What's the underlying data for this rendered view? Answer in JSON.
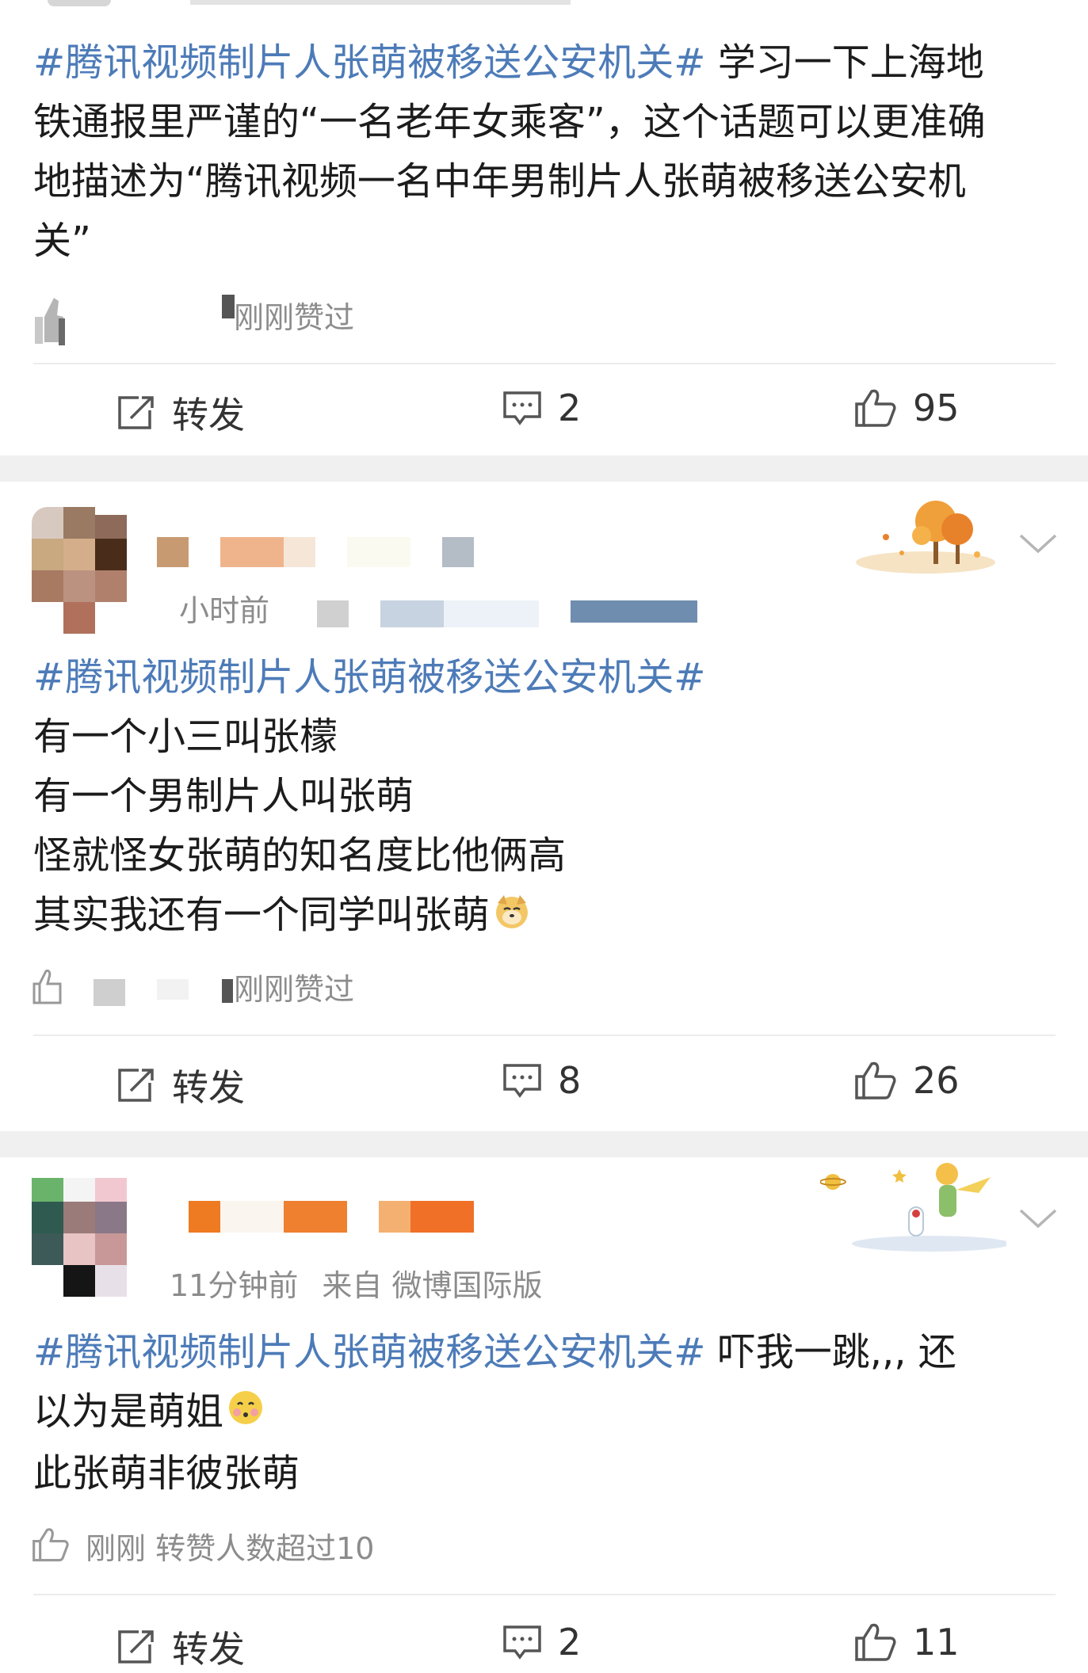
{
  "posts": [
    {
      "text_lines": [
        {
          "topic": "#腾讯视频制片人张萌被移送公安机关#",
          "rest": " 学习一下上海地"
        },
        {
          "topic": "",
          "rest": "铁通报里严谨的“一名老年女乘客”，这个话题可以更准确"
        },
        {
          "topic": "",
          "rest": "地描述为“腾讯视频一名中年男制片人张萌被移送公安机"
        },
        {
          "topic": "",
          "rest": "关”"
        }
      ],
      "like_note": "刚刚赞过",
      "actions": {
        "repost": "转发",
        "comments": "2",
        "likes": "95"
      }
    },
    {
      "time_fragment": "小时前",
      "text_lines": [
        {
          "topic": "#腾讯视频制片人张萌被移送公安机关#",
          "rest": ""
        },
        {
          "topic": "",
          "rest": "有一个小三叫张檬"
        },
        {
          "topic": "",
          "rest": "有一个男制片人叫张萌"
        },
        {
          "topic": "",
          "rest": "怪就怪女张萌的知名度比他俩高"
        },
        {
          "topic": "",
          "rest": "其实我还有一个同学叫张萌"
        }
      ],
      "like_note": "刚刚赞过",
      "actions": {
        "repost": "转发",
        "comments": "8",
        "likes": "26"
      }
    },
    {
      "meta": {
        "time": "11分钟前",
        "from": "来自 微博国际版"
      },
      "text_lines": [
        {
          "topic": "#腾讯视频制片人张萌被移送公安机关#",
          "rest": " 吓我一跳,,, 还"
        },
        {
          "topic": "",
          "rest": "以为是萌姐"
        },
        {
          "topic": "",
          "rest": "此张萌非彼张萌"
        }
      ],
      "like_note": "刚刚 转赞人数超过10",
      "actions": {
        "repost": "转发",
        "comments": "2",
        "likes": "11"
      }
    }
  ],
  "icons": {
    "repost": "repost-icon",
    "comment": "comment-icon",
    "like": "thumbs-up-icon",
    "more": "chevron-down-icon",
    "emoji_doge": "doge-emoji-icon",
    "emoji_shy": "shy-face-emoji-icon"
  },
  "colors": {
    "topic": "#4d7bb8",
    "band": "#f0f0f0",
    "meta": "#8c8c8c"
  }
}
